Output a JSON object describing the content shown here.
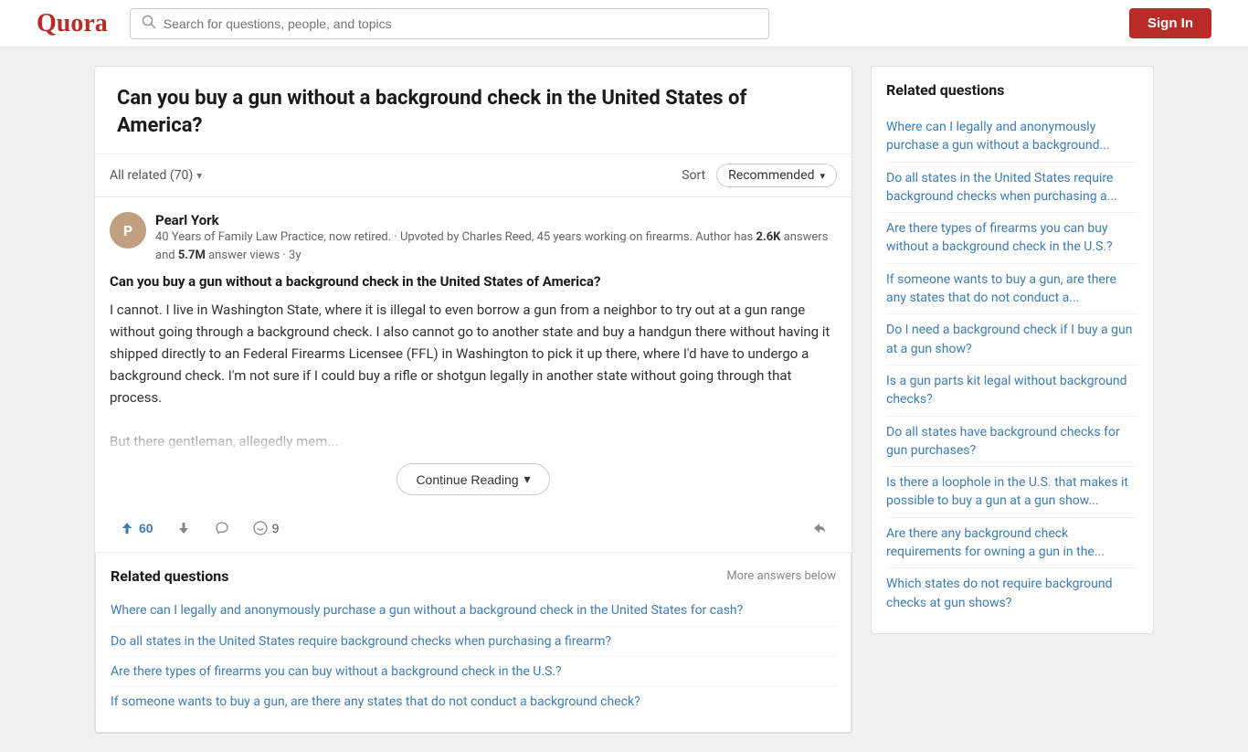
{
  "header": {
    "logo": "Quora",
    "search_placeholder": "Search for questions, people, and topics",
    "sign_in_label": "Sign In"
  },
  "question": {
    "title": "Can you buy a gun without a background check in the United States of America?",
    "all_related_label": "All related (70)",
    "sort_label": "Sort",
    "sort_value": "Recommended"
  },
  "answer": {
    "author_name": "Pearl York",
    "author_meta": "40 Years of Family Law Practice, now retired. · Upvoted by Charles Reed, 45 years working on firearms.",
    "author_stats": "Author has 2.6K answers and 5.7M answer views · 3y",
    "answer_question": "Can you buy a gun without a background check in the United States of America?",
    "body_p1": "I cannot. I live in Washington State, where it is illegal to even borrow a gun from a neighbor to try out at a gun range without going through a background check. I also cannot go to another state and buy a handgun there without having it shipped directly to an Federal Firearms Licensee (FFL) in Washington to pick it up there, where I'd have to undergo a background check. I'm not sure if I could buy a rifle or shotgun legally in another state without going through that process.",
    "body_p2": "But there gentleman, allegedly mem...",
    "continue_reading": "Continue Reading",
    "upvotes": "60",
    "comments": "9"
  },
  "main_related": {
    "title": "Related questions",
    "more_answers": "More answers below",
    "links": [
      "Where can I legally and anonymously purchase a gun without a background check in the United States for cash?",
      "Do all states in the United States require background checks when purchasing a firearm?",
      "Are there types of firearms you can buy without a background check in the U.S.?",
      "If someone wants to buy a gun, are there any states that do not conduct a background check?"
    ]
  },
  "sidebar": {
    "title": "Related questions",
    "links": [
      "Where can I legally and anonymously purchase a gun without a background...",
      "Do all states in the United States require background checks when purchasing a...",
      "Are there types of firearms you can buy without a background check in the U.S.?",
      "If someone wants to buy a gun, are there any states that do not conduct a...",
      "Do I need a background check if I buy a gun at a gun show?",
      "Is a gun parts kit legal without background checks?",
      "Do all states have background checks for gun purchases?",
      "Is there a loophole in the U.S. that makes it possible to buy a gun at a gun show...",
      "Are there any background check requirements for owning a gun in the...",
      "Which states do not require background checks at gun shows?"
    ]
  }
}
